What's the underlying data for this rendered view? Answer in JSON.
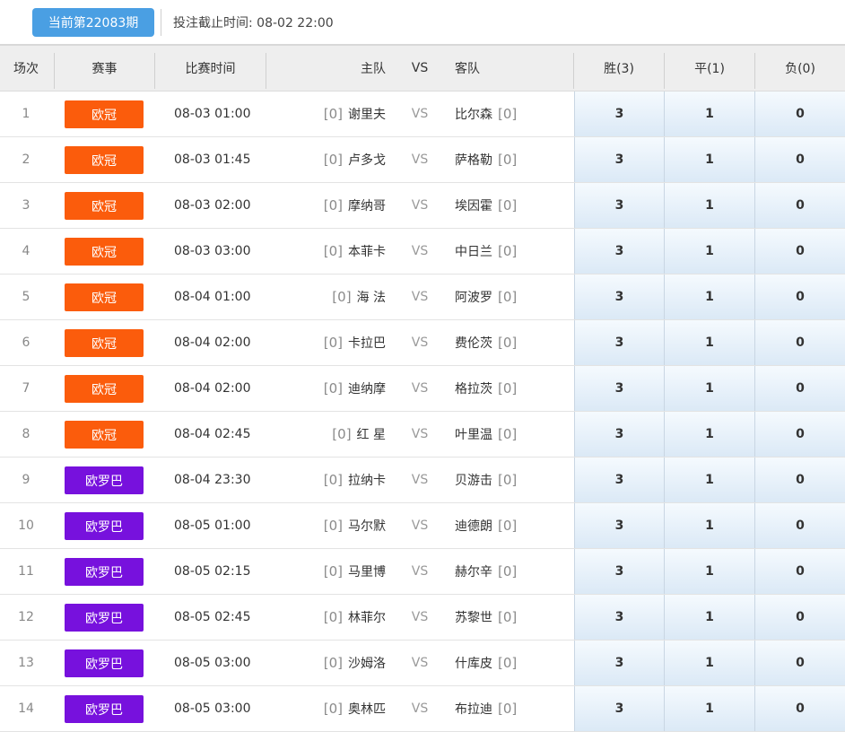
{
  "top": {
    "period_label": "当前第22083期",
    "deadline_label": "投注截止时间:",
    "deadline_value": "08-02 22:00"
  },
  "header": {
    "idx": "场次",
    "league": "赛事",
    "time": "比赛时间",
    "home": "主队",
    "vs": "VS",
    "away": "客队",
    "win": "胜(3)",
    "draw": "平(1)",
    "lose": "负(0)"
  },
  "colors": {
    "ucl": "#fb5c0c",
    "uel": "#7711dd",
    "period_btn": "#4a9fe3"
  },
  "matches": [
    {
      "idx": "1",
      "league": "欧冠",
      "lc": "ucl",
      "time": "08-03 01:00",
      "home_rank": "[0]",
      "home": "谢里夫",
      "vs": "VS",
      "away": "比尔森",
      "away_rank": "[0]",
      "win": "3",
      "draw": "1",
      "lose": "0"
    },
    {
      "idx": "2",
      "league": "欧冠",
      "lc": "ucl",
      "time": "08-03 01:45",
      "home_rank": "[0]",
      "home": "卢多戈",
      "vs": "VS",
      "away": "萨格勒",
      "away_rank": "[0]",
      "win": "3",
      "draw": "1",
      "lose": "0"
    },
    {
      "idx": "3",
      "league": "欧冠",
      "lc": "ucl",
      "time": "08-03 02:00",
      "home_rank": "[0]",
      "home": "摩纳哥",
      "vs": "VS",
      "away": "埃因霍",
      "away_rank": "[0]",
      "win": "3",
      "draw": "1",
      "lose": "0"
    },
    {
      "idx": "4",
      "league": "欧冠",
      "lc": "ucl",
      "time": "08-03 03:00",
      "home_rank": "[0]",
      "home": "本菲卡",
      "vs": "VS",
      "away": "中日兰",
      "away_rank": "[0]",
      "win": "3",
      "draw": "1",
      "lose": "0"
    },
    {
      "idx": "5",
      "league": "欧冠",
      "lc": "ucl",
      "time": "08-04 01:00",
      "home_rank": "[0]",
      "home": "海 法",
      "vs": "VS",
      "away": "阿波罗",
      "away_rank": "[0]",
      "win": "3",
      "draw": "1",
      "lose": "0"
    },
    {
      "idx": "6",
      "league": "欧冠",
      "lc": "ucl",
      "time": "08-04 02:00",
      "home_rank": "[0]",
      "home": "卡拉巴",
      "vs": "VS",
      "away": "费伦茨",
      "away_rank": "[0]",
      "win": "3",
      "draw": "1",
      "lose": "0"
    },
    {
      "idx": "7",
      "league": "欧冠",
      "lc": "ucl",
      "time": "08-04 02:00",
      "home_rank": "[0]",
      "home": "迪纳摩",
      "vs": "VS",
      "away": "格拉茨",
      "away_rank": "[0]",
      "win": "3",
      "draw": "1",
      "lose": "0"
    },
    {
      "idx": "8",
      "league": "欧冠",
      "lc": "ucl",
      "time": "08-04 02:45",
      "home_rank": "[0]",
      "home": "红 星",
      "vs": "VS",
      "away": "叶里温",
      "away_rank": "[0]",
      "win": "3",
      "draw": "1",
      "lose": "0"
    },
    {
      "idx": "9",
      "league": "欧罗巴",
      "lc": "uel",
      "time": "08-04 23:30",
      "home_rank": "[0]",
      "home": "拉纳卡",
      "vs": "VS",
      "away": "贝游击",
      "away_rank": "[0]",
      "win": "3",
      "draw": "1",
      "lose": "0"
    },
    {
      "idx": "10",
      "league": "欧罗巴",
      "lc": "uel",
      "time": "08-05 01:00",
      "home_rank": "[0]",
      "home": "马尔默",
      "vs": "VS",
      "away": "迪德朗",
      "away_rank": "[0]",
      "win": "3",
      "draw": "1",
      "lose": "0"
    },
    {
      "idx": "11",
      "league": "欧罗巴",
      "lc": "uel",
      "time": "08-05 02:15",
      "home_rank": "[0]",
      "home": "马里博",
      "vs": "VS",
      "away": "赫尔辛",
      "away_rank": "[0]",
      "win": "3",
      "draw": "1",
      "lose": "0"
    },
    {
      "idx": "12",
      "league": "欧罗巴",
      "lc": "uel",
      "time": "08-05 02:45",
      "home_rank": "[0]",
      "home": "林菲尔",
      "vs": "VS",
      "away": "苏黎世",
      "away_rank": "[0]",
      "win": "3",
      "draw": "1",
      "lose": "0"
    },
    {
      "idx": "13",
      "league": "欧罗巴",
      "lc": "uel",
      "time": "08-05 03:00",
      "home_rank": "[0]",
      "home": "沙姆洛",
      "vs": "VS",
      "away": "什库皮",
      "away_rank": "[0]",
      "win": "3",
      "draw": "1",
      "lose": "0"
    },
    {
      "idx": "14",
      "league": "欧罗巴",
      "lc": "uel",
      "time": "08-05 03:00",
      "home_rank": "[0]",
      "home": "奥林匹",
      "vs": "VS",
      "away": "布拉迪",
      "away_rank": "[0]",
      "win": "3",
      "draw": "1",
      "lose": "0"
    }
  ]
}
